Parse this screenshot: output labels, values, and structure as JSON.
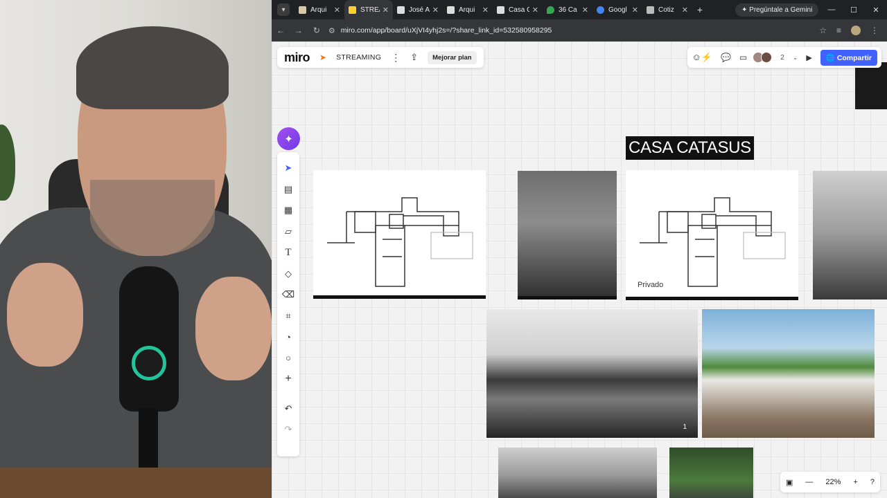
{
  "browser": {
    "tabs": [
      {
        "label": "Arqui",
        "favicon_color": "#d9c9a3"
      },
      {
        "label": "STREA",
        "favicon_color": "#ffd02f",
        "active": true
      },
      {
        "label": "José A",
        "favicon_color": "#dddddd"
      },
      {
        "label": "Arqui",
        "favicon_color": "#dddddd"
      },
      {
        "label": "Casa C",
        "favicon_color": "#dddddd"
      },
      {
        "label": "36 Ca",
        "favicon_color": "#34a853"
      },
      {
        "label": "Googl",
        "favicon_color": "#4285f4"
      },
      {
        "label": "Cotiz",
        "favicon_color": "#bbbbbb"
      }
    ],
    "gemini_label": "Pregúntale a Gemini",
    "url": "miro.com/app/board/uXjVI4yhj2s=/?share_link_id=532580958295"
  },
  "miro": {
    "logo": "miro",
    "board_name": "STREAMING",
    "upgrade_label": "Mejorar plan",
    "collaborators_count": "2",
    "share_label": "Compartir",
    "zoom_level": "22%",
    "board_title": "CASA CATASUS",
    "caption_private": "Privado",
    "photo_number": "1"
  },
  "colors": {
    "accent": "#4262ff",
    "ai_button": "#8a44ec"
  }
}
